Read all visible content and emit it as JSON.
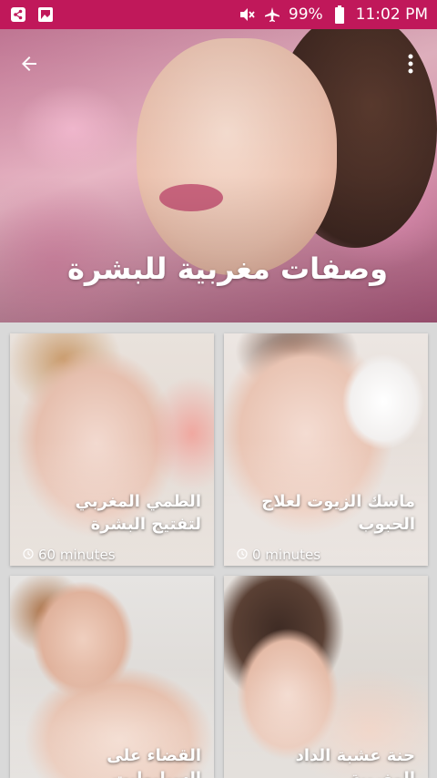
{
  "status_bar": {
    "battery": "99%",
    "time": "11:02 PM",
    "left_icons": [
      "share-icon",
      "gallery-icon"
    ],
    "right_icons": [
      "mute-icon",
      "airplane-icon",
      "battery-icon"
    ]
  },
  "header": {
    "title": "وصفات مغربية للبشرة",
    "back_icon": "back-arrow-icon",
    "menu_icon": "more-vert-icon"
  },
  "recipes": [
    {
      "title": "ماسك الزيوت لعلاج الحبوب",
      "time": "0 minutes"
    },
    {
      "title": "الطمي المغربي لتفتيح البشرة",
      "time": "60 minutes"
    },
    {
      "title": "حنة عشبة الداد المغربية",
      "time": ""
    },
    {
      "title": "القضاء على السيليوليت",
      "time": ""
    }
  ],
  "colors": {
    "status_bar": "#c0185a",
    "background": "#d9d9d9"
  }
}
